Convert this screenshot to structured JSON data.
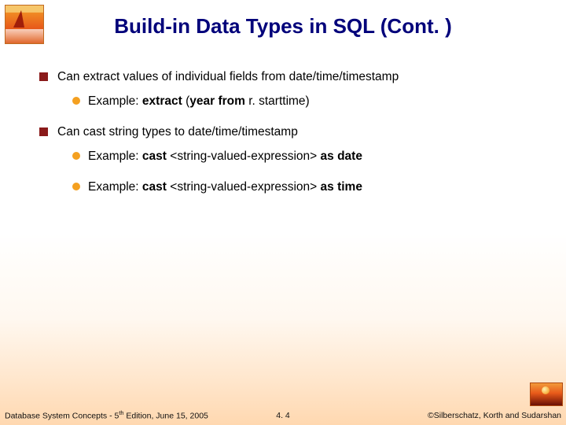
{
  "title": "Build-in Data Types in SQL (Cont. )",
  "bullets": {
    "p1": "Can extract values of individual fields from date/time/timestamp",
    "p1e_pre": "Example:   ",
    "p1e_b1": "extract ",
    "p1e_mid1": "(",
    "p1e_b2": "year from ",
    "p1e_txt": "r. starttime)",
    "p2": "Can cast string types to date/time/timestamp",
    "p2e1_pre": "Example:   ",
    "p2e1_b1": "cast   ",
    "p2e1_txt": "<string-valued-expression> ",
    "p2e1_b2": "as date",
    "p2e2_pre": "Example:   ",
    "p2e2_b1": "cast   ",
    "p2e2_txt": "<string-valued-expression> ",
    "p2e2_b2": "as time"
  },
  "footer": {
    "left_a": "Database System Concepts - 5",
    "left_sup": "th",
    "left_b": " Edition,  June  15, 2005",
    "mid": "4. 4",
    "right": "©Silberschatz, Korth and Sudarshan"
  }
}
